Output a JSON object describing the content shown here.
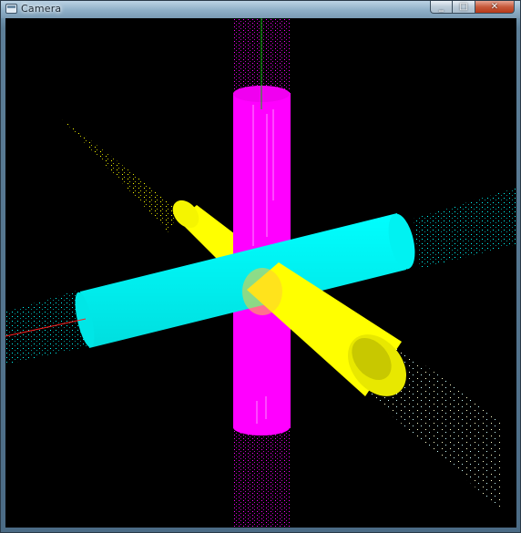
{
  "window": {
    "title": "Camera",
    "minimize_label": "_",
    "maximize_label": "□",
    "close_label": "✕",
    "icons": {
      "app": "app-icon",
      "minimize": "minimize-icon",
      "maximize": "maximize-icon",
      "close": "close-icon"
    }
  },
  "scene": {
    "background": "#000000",
    "colors": {
      "vertical_cylinder": "#ff00ff",
      "horizontal_cylinder": "#00ffff",
      "diagonal_cylinder": "#ffff00",
      "y_axis": "#00c000",
      "x_axis": "#ff2020"
    }
  }
}
